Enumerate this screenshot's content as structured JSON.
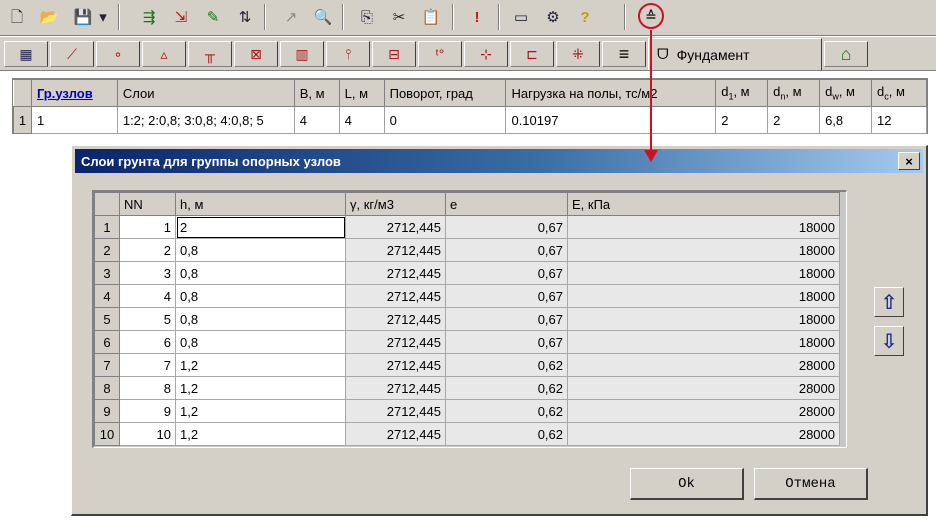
{
  "toolbar": {
    "icons": [
      "new-file-icon",
      "open-folder-icon",
      "save-icon",
      "dropdown-arrow-icon",
      "add-row-icon",
      "delete-row-icon",
      "edit-icon",
      "sort-icon",
      "pointer-icon",
      "zoom-icon",
      "copy-icon",
      "cut-icon",
      "paste-icon",
      "exclamation-icon",
      "window-icon",
      "settings-icon",
      "help-icon",
      "foundation-tool-icon"
    ],
    "glyphs": [
      "🗋",
      "📂",
      "💾",
      "▾",
      "⇶",
      "⇲",
      "✎",
      "⇅",
      "↗",
      "🔍",
      "⎘",
      "✂",
      "📋",
      "!",
      "▭",
      "⚙",
      "?",
      "≙"
    ]
  },
  "tabs": {
    "glyphs": [
      "▦",
      "⟋",
      "∘",
      "▵",
      "╥",
      "⊠",
      "▥",
      "⫯",
      "⊟",
      "ᵗ°",
      "⊹",
      "⊏",
      "⁜"
    ],
    "active_glyph": "≡",
    "active_icon_glyph": "ᗜ",
    "active_label": "Фундамент",
    "home_glyph": "⌂"
  },
  "upper_grid": {
    "headers": {
      "group": "Гр.узлов",
      "layers": "Слои",
      "b": "B, м",
      "l": "L, м",
      "rotation": "Поворот, град",
      "load": "Нагрузка на полы, тс/м2",
      "d1_sym": "d",
      "d1_sub": "1",
      "d1_unit": ", м",
      "dn_sym": "d",
      "dn_sub": "n",
      "dn_unit": ", м",
      "dw_sym": "d",
      "dw_sub": "w",
      "dw_unit": ", м",
      "dc_sym": "d",
      "dc_sub": "c",
      "dc_unit": ", м"
    },
    "row": {
      "num": "1",
      "group": "1",
      "layers": "1:2; 2:0,8; 3:0,8; 4:0,8; 5",
      "b": "4",
      "l": "4",
      "rotation": "0",
      "load": "0.10197",
      "d1": "2",
      "dn": "2",
      "dw": "6,8",
      "dc": "12"
    }
  },
  "dialog": {
    "title": "Слои грунта для группы опорных узлов",
    "close": "×",
    "headers": {
      "nn": "NN",
      "h": "h, м",
      "gamma": "γ, кг/м3",
      "e": "e",
      "E": "E, кПа"
    },
    "rows": [
      {
        "r": "1",
        "nn": "1",
        "h": "2",
        "gamma": "2712,445",
        "e": "0,67",
        "E": "18000"
      },
      {
        "r": "2",
        "nn": "2",
        "h": "0,8",
        "gamma": "2712,445",
        "e": "0,67",
        "E": "18000"
      },
      {
        "r": "3",
        "nn": "3",
        "h": "0,8",
        "gamma": "2712,445",
        "e": "0,67",
        "E": "18000"
      },
      {
        "r": "4",
        "nn": "4",
        "h": "0,8",
        "gamma": "2712,445",
        "e": "0,67",
        "E": "18000"
      },
      {
        "r": "5",
        "nn": "5",
        "h": "0,8",
        "gamma": "2712,445",
        "e": "0,67",
        "E": "18000"
      },
      {
        "r": "6",
        "nn": "6",
        "h": "0,8",
        "gamma": "2712,445",
        "e": "0,67",
        "E": "18000"
      },
      {
        "r": "7",
        "nn": "7",
        "h": "1,2",
        "gamma": "2712,445",
        "e": "0,62",
        "E": "28000"
      },
      {
        "r": "8",
        "nn": "8",
        "h": "1,2",
        "gamma": "2712,445",
        "e": "0,62",
        "E": "28000"
      },
      {
        "r": "9",
        "nn": "9",
        "h": "1,2",
        "gamma": "2712,445",
        "e": "0,62",
        "E": "28000"
      },
      {
        "r": "10",
        "nn": "10",
        "h": "1,2",
        "gamma": "2712,445",
        "e": "0,62",
        "E": "28000"
      }
    ],
    "up_glyph": "⇧",
    "down_glyph": "⇩",
    "ok_label": "Ok",
    "cancel_label": "Отмена"
  },
  "annotation_color": "#cc1122"
}
